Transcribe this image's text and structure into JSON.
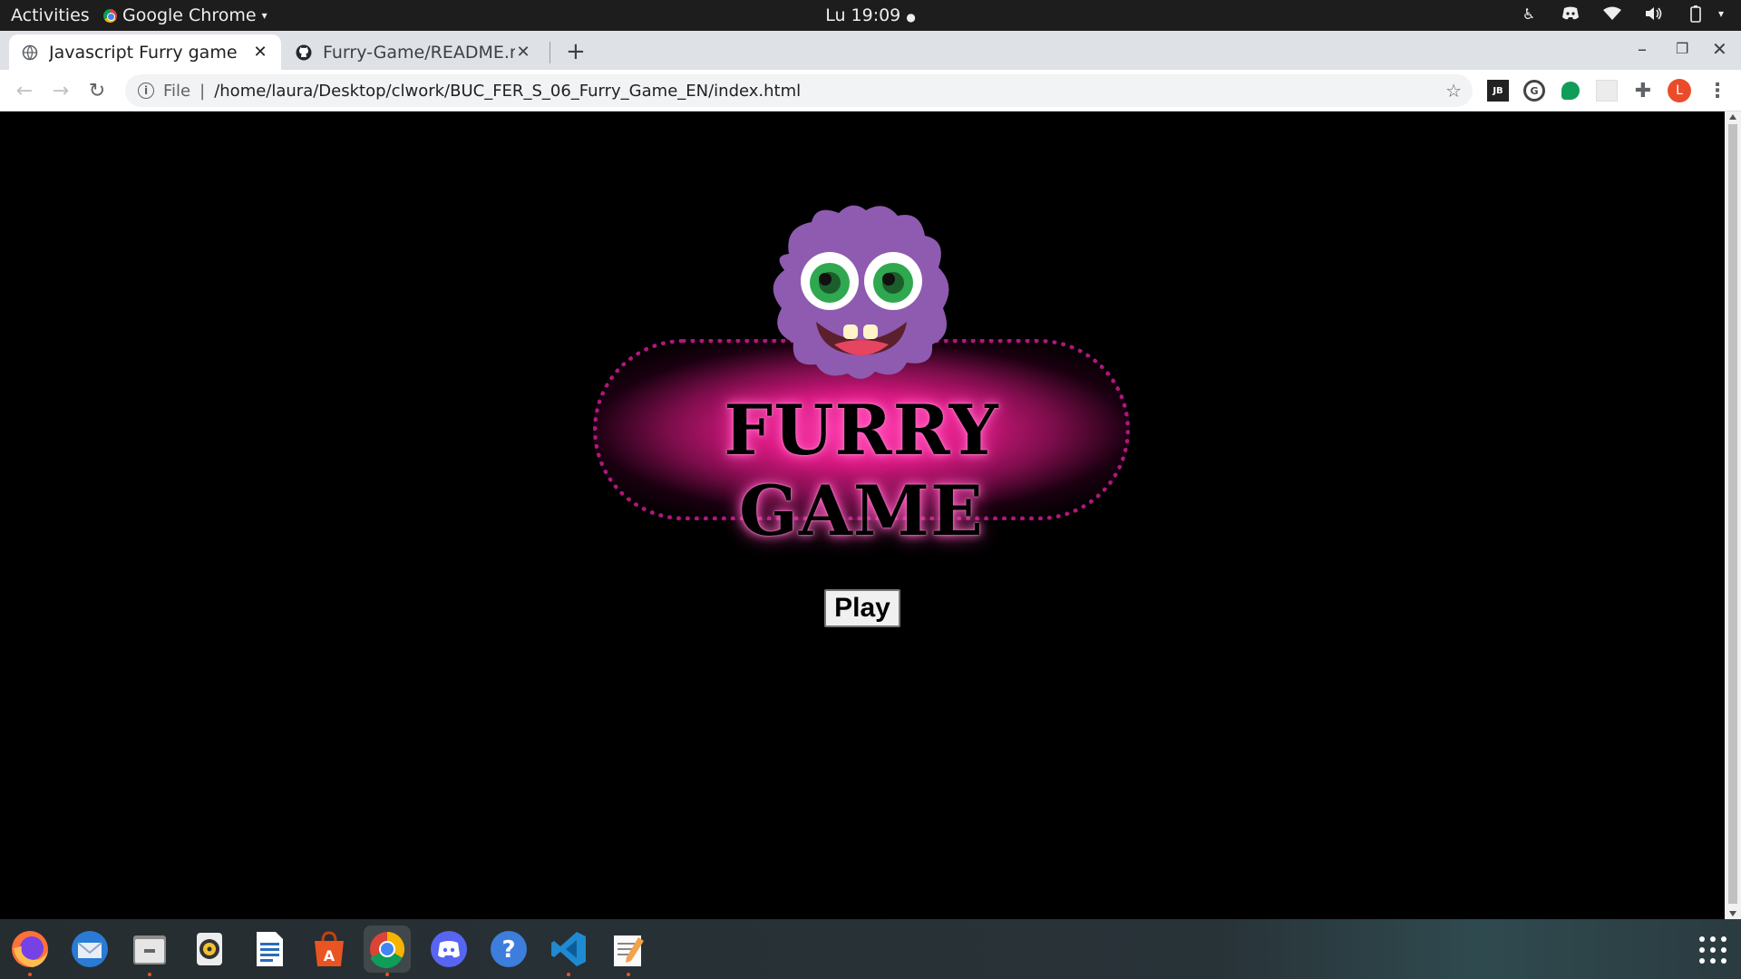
{
  "system_bar": {
    "activities": "Activities",
    "app_name": "Google Chrome",
    "clock": "Lu 19:09"
  },
  "browser": {
    "tabs": [
      {
        "title": "Javascript Furry game",
        "active": true
      },
      {
        "title": "Furry-Game/README.md",
        "active": false
      }
    ],
    "address": {
      "scheme": "File",
      "url": "/home/laura/Desktop/clwork/BUC_FER_S_06_Furry_Game_EN/index.html"
    },
    "profile_initial": "L",
    "extension_label": "JB"
  },
  "page": {
    "logo_text": "FURRY GAME",
    "play_button": "Play",
    "colors": {
      "background": "#000000",
      "neon_pink": "#ff3fae",
      "dotted_border": "#b0177d",
      "monster_purple": "#8e5bb0",
      "eye_green": "#2fa84f"
    }
  },
  "dock": {
    "apps": [
      "firefox-icon",
      "thunderbird-icon",
      "files-icon",
      "rhythmbox-icon",
      "writer-icon",
      "software-icon",
      "chrome-icon",
      "discord-icon",
      "help-icon",
      "vscode-icon",
      "text-editor-icon"
    ]
  }
}
